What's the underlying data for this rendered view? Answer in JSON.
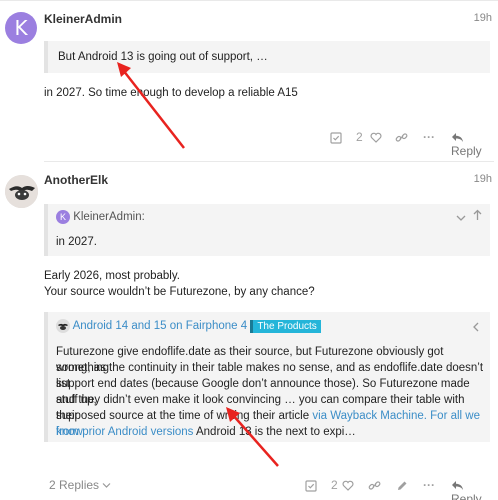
{
  "posts": [
    {
      "username": "KleinerAdmin",
      "avatar_letter": "K",
      "time": "19h",
      "quote_text": "But Android 13 is going out of support, …",
      "body": "in 2027. So time enough to develop a reliable A15",
      "like_count": "2",
      "reply_label": "Reply"
    },
    {
      "username": "AnotherElk",
      "time": "19h",
      "quote": {
        "author": "KleinerAdmin:",
        "author_letter": "K",
        "text": "in 2027."
      },
      "body_line1": "Early 2026, most probably.",
      "body_line2": "Your source wouldn’t be Futurezone, by any chance?",
      "onebox": {
        "title": "Android 14 and 15 on Fairphone 4",
        "tag": "The Products",
        "line1": "Futurezone give endoflife.date as their source, but Futurezone obviously got something",
        "line2": "wrong, as the continuity in their table makes no sense, and as endoflife.date doesn’t list",
        "line3": "support end dates (because Google don’t announce those). So Futurezone made stuff up,",
        "line4a": "and they didn’t even make it look convincing … you can compare their table with their",
        "line5a": "supposed source at the time of writing their article ",
        "line5_link1": "via Wayback Machine",
        "line5_link2": ". For all we know",
        "line6_link": "from prior Android versions",
        "line6_tail": " Android 13 is the next to expi…"
      },
      "replies_label": "2 Replies",
      "like_count": "2",
      "reply_label": "Reply"
    }
  ],
  "colors": {
    "accent_link": "#3b8dc7",
    "avatar_purple": "#9b7fe0",
    "tag_blue": "#24b5d9",
    "arrow_red": "#e8231f"
  }
}
